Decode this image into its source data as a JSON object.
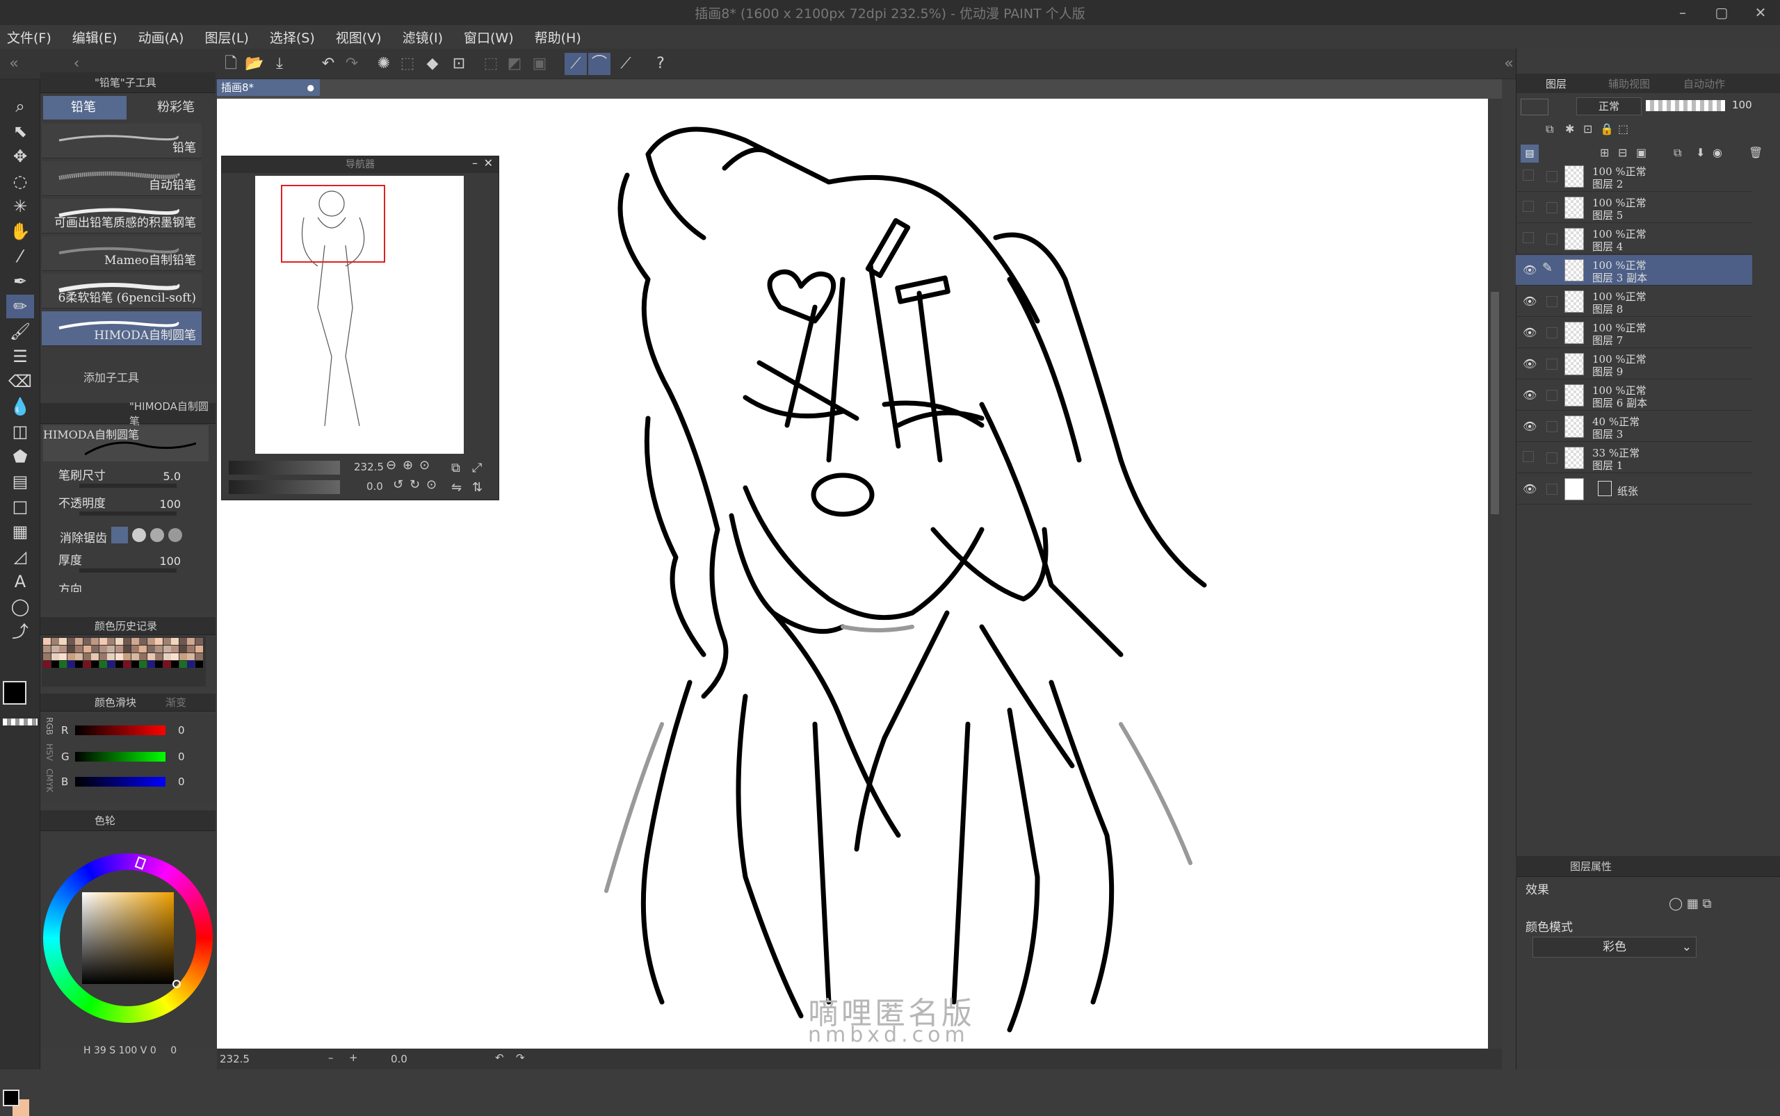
{
  "window": {
    "title": "插画8* (1600 x 2100px 72dpi 232.5%) - 优动漫 PAINT 个人版",
    "controls": [
      "–",
      "▢",
      "✕"
    ]
  },
  "menu": [
    "文件(F)",
    "编辑(E)",
    "动画(A)",
    "图层(L)",
    "选择(S)",
    "视图(V)",
    "滤镜(I)",
    "窗口(W)",
    "帮助(H)"
  ],
  "subtool_panel": {
    "header": "\"铅笔\"子工具",
    "tabs": [
      "铅笔",
      "粉彩笔"
    ],
    "brushes": [
      "铅笔",
      "自动铅笔",
      "可画出铅笔质感的积墨钢笔",
      "Mameo自制铅笔",
      "6柔软铅笔 (6pencil-soft)",
      "HIMODA自制圆笔"
    ],
    "selected_brush": "HIMODA自制圆笔",
    "add_label": "添加子工具"
  },
  "tool_property": {
    "header": "\"HIMODA自制圆笔",
    "preview_label": "HIMODA自制圆笔",
    "brush_size_label": "笔刷尺寸",
    "brush_size": "5.0",
    "opacity_label": "不透明度",
    "opacity": "100",
    "antialias_label": "消除锯齿",
    "thickness_label": "厚度",
    "thickness": "100",
    "direction_label": "方向"
  },
  "color_history": {
    "header": "颜色历史记录"
  },
  "color_slider": {
    "header": "颜色滑块",
    "tab2": "渐变",
    "modes": [
      "RGB",
      "HSV",
      "CMYK"
    ],
    "r_label": "R",
    "g_label": "G",
    "b_label": "B",
    "r": "0",
    "g": "0",
    "b": "0"
  },
  "color_wheel": {
    "header": "色轮",
    "h": "39",
    "s": "100",
    "v": "0",
    "h_label": "H",
    "s_label": "S",
    "v_label": "V",
    "extra": "0"
  },
  "document": {
    "tab_title": "插画8*",
    "zoom": "232.5",
    "rotation": "0.0",
    "status_zoom": "232.5",
    "status_rotation": "0.0"
  },
  "navigator": {
    "title": "导航器",
    "zoom": "232.5",
    "rotation": "0.0"
  },
  "layer_panel": {
    "tabs": [
      "图层",
      "辅助视图",
      "自动动作"
    ],
    "blend_mode": "正常",
    "opacity": "100",
    "layers": [
      {
        "opacity_mode": "100 %正常",
        "name": "图层 2",
        "visible": false,
        "selected": false
      },
      {
        "opacity_mode": "100 %正常",
        "name": "图层 5",
        "visible": false,
        "selected": false
      },
      {
        "opacity_mode": "100 %正常",
        "name": "图层 4",
        "visible": false,
        "selected": false
      },
      {
        "opacity_mode": "100 %正常",
        "name": "图层 3 副本",
        "visible": true,
        "selected": true
      },
      {
        "opacity_mode": "100 %正常",
        "name": "图层 8",
        "visible": true,
        "selected": false
      },
      {
        "opacity_mode": "100 %正常",
        "name": "图层 7",
        "visible": true,
        "selected": false
      },
      {
        "opacity_mode": "100 %正常",
        "name": "图层 9",
        "visible": true,
        "selected": false
      },
      {
        "opacity_mode": "100 %正常",
        "name": "图层 6 副本",
        "visible": true,
        "selected": false
      },
      {
        "opacity_mode": "40 %正常",
        "name": "图层 3",
        "visible": true,
        "selected": false
      },
      {
        "opacity_mode": "33 %正常",
        "name": "图层 1",
        "visible": false,
        "selected": false
      },
      {
        "opacity_mode": "",
        "name": "纸张",
        "visible": true,
        "selected": false
      }
    ]
  },
  "layer_property": {
    "header": "图层属性",
    "effect_label": "效果",
    "color_mode_label": "颜色模式",
    "color_mode": "彩色"
  },
  "watermark": {
    "line1": "嘀哩匿名版",
    "line2": "nmbxd.com"
  },
  "colors": {
    "accent": "#56698f",
    "main_color": "#000000",
    "sub_color": "#f2c09a"
  }
}
